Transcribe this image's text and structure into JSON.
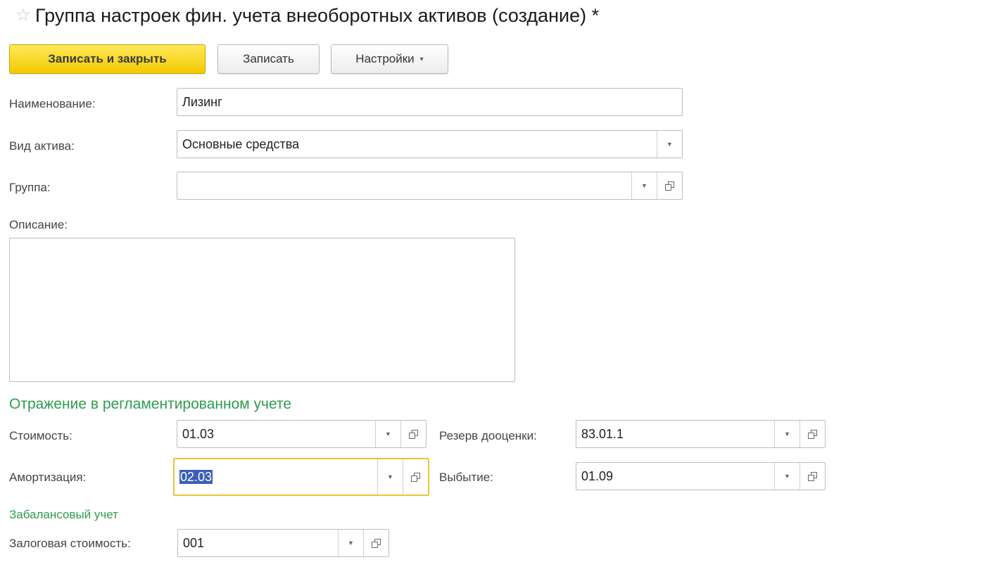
{
  "window": {
    "title": "Группа настроек фин. учета внеоборотных активов (создание) *",
    "favorite_icon": "star-outline-icon"
  },
  "toolbar": {
    "save_close_label": "Записать и закрыть",
    "save_label": "Записать",
    "settings_label": "Настройки",
    "dropdown_glyph": "▾"
  },
  "form": {
    "name_label": "Наименование:",
    "name_value": "Лизинг",
    "asset_type_label": "Вид актива:",
    "asset_type_value": "Основные средства",
    "group_label": "Группа:",
    "group_value": "",
    "description_label": "Описание:",
    "description_value": ""
  },
  "regulated": {
    "section_title": "Отражение в регламентированном учете",
    "cost_label": "Стоимость:",
    "cost_value": "01.03",
    "depreciation_label": "Амортизация:",
    "depreciation_value": "02.03",
    "revaluation_label": "Резерв дооценки:",
    "revaluation_value": "83.01.1",
    "disposal_label": "Выбытие:",
    "disposal_value": "01.09"
  },
  "offbalance": {
    "section_title": "Забалансовый учет",
    "pledge_label": "Залоговая стоимость:",
    "pledge_value": "001"
  },
  "colors": {
    "accent_yellow": "#f3c900",
    "section_green": "#2e9c4e",
    "selection_blue": "#3b5fb8"
  }
}
